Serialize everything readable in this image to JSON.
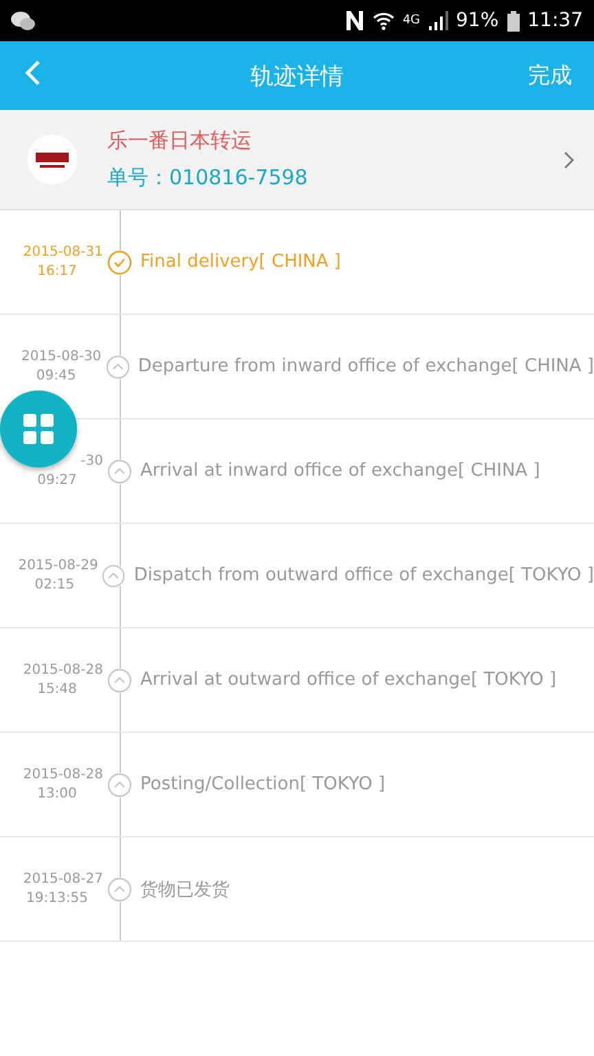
{
  "status_bar": {
    "network": "4G",
    "battery": "91%",
    "time": "11:37"
  },
  "header": {
    "title": "轨迹详情",
    "action": "完成"
  },
  "merchant": {
    "name": "乐一番日本转运",
    "order_label": "单号：",
    "order_number": "010816-7598"
  },
  "events": [
    {
      "date": "2015-08-31",
      "time": "16:17",
      "text": "Final delivery[ CHINA ]",
      "current": true
    },
    {
      "date": "2015-08-30",
      "time": "09:45",
      "text": "Departure from inward office of exchange[ CHINA ]",
      "current": false
    },
    {
      "date": "-30",
      "time": "09:27",
      "text": "Arrival at inward office of exchange[ CHINA ]",
      "current": false
    },
    {
      "date": "2015-08-29",
      "time": "02:15",
      "text": "Dispatch from outward office of exchange[ TOKYO ]",
      "current": false
    },
    {
      "date": "2015-08-28",
      "time": "15:48",
      "text": "Arrival at outward office of exchange[ TOKYO ]",
      "current": false
    },
    {
      "date": "2015-08-28",
      "time": "13:00",
      "text": "Posting/Collection[ TOKYO ]",
      "current": false
    },
    {
      "date": "2015-08-27",
      "time": "19:13:55",
      "text": "货物已发货",
      "current": false
    }
  ]
}
